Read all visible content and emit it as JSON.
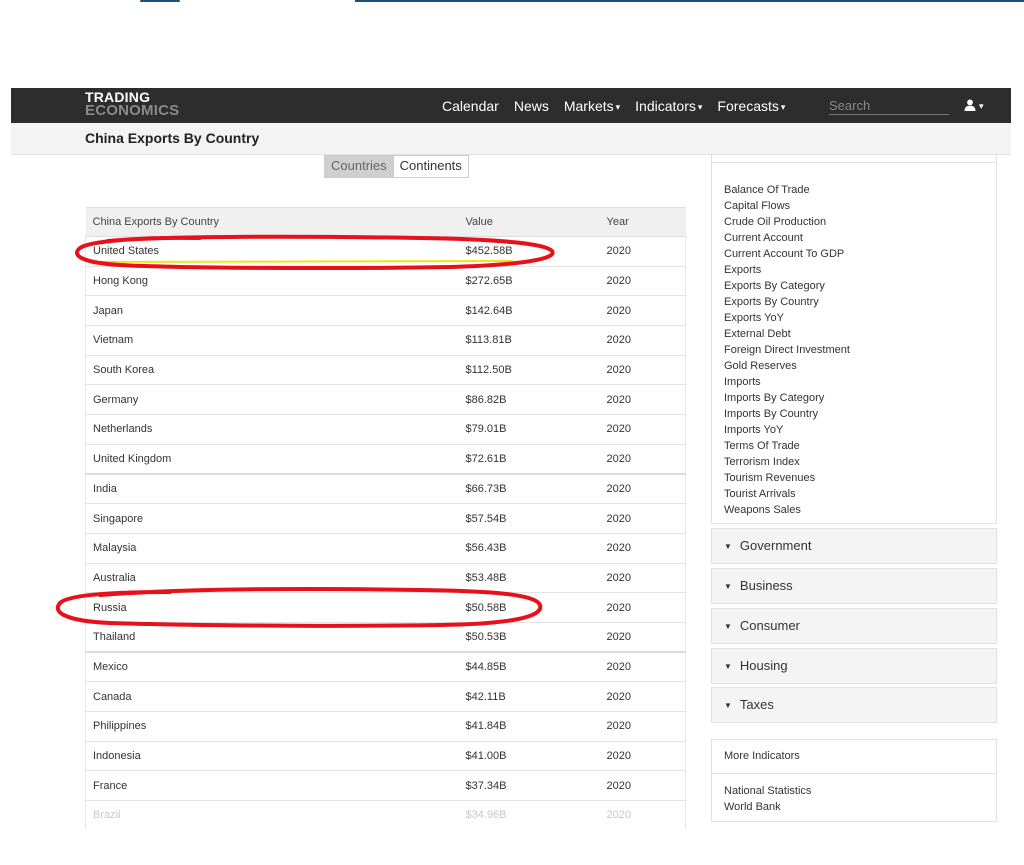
{
  "navbar": {
    "logo_line1": "TRADING",
    "logo_line2": "ECONOMICS",
    "menu": [
      {
        "label": "Calendar",
        "has_caret": false
      },
      {
        "label": "News",
        "has_caret": false
      },
      {
        "label": "Markets",
        "has_caret": true
      },
      {
        "label": "Indicators",
        "has_caret": true
      },
      {
        "label": "Forecasts",
        "has_caret": true
      }
    ],
    "search_placeholder": "Search",
    "user_icon": "user-icon"
  },
  "page": {
    "title": "China Exports By Country"
  },
  "toggle": {
    "options": [
      "Countries",
      "Continents"
    ],
    "active": "Countries"
  },
  "table": {
    "headers": [
      "China Exports By Country",
      "Value",
      "Year"
    ],
    "rows": [
      {
        "country": "United States",
        "value": "$452.58B",
        "year": "2020"
      },
      {
        "country": "Hong Kong",
        "value": "$272.65B",
        "year": "2020"
      },
      {
        "country": "Japan",
        "value": "$142.64B",
        "year": "2020"
      },
      {
        "country": "Vietnam",
        "value": "$113.81B",
        "year": "2020"
      },
      {
        "country": "South Korea",
        "value": "$112.50B",
        "year": "2020"
      },
      {
        "country": "Germany",
        "value": "$86.82B",
        "year": "2020"
      },
      {
        "country": "Netherlands",
        "value": "$79.01B",
        "year": "2020"
      },
      {
        "country": "United Kingdom",
        "value": "$72.61B",
        "year": "2020"
      },
      {
        "country": "India",
        "value": "$66.73B",
        "year": "2020"
      },
      {
        "country": "Singapore",
        "value": "$57.54B",
        "year": "2020"
      },
      {
        "country": "Malaysia",
        "value": "$56.43B",
        "year": "2020"
      },
      {
        "country": "Australia",
        "value": "$53.48B",
        "year": "2020"
      },
      {
        "country": "Russia",
        "value": "$50.58B",
        "year": "2020"
      },
      {
        "country": "Thailand",
        "value": "$50.53B",
        "year": "2020"
      },
      {
        "country": "Mexico",
        "value": "$44.85B",
        "year": "2020"
      },
      {
        "country": "Canada",
        "value": "$42.11B",
        "year": "2020"
      },
      {
        "country": "Philippines",
        "value": "$41.84B",
        "year": "2020"
      },
      {
        "country": "Indonesia",
        "value": "$41.00B",
        "year": "2020"
      },
      {
        "country": "France",
        "value": "$37.34B",
        "year": "2020"
      },
      {
        "country": "Brazil",
        "value": "$34.96B",
        "year": "2020"
      }
    ]
  },
  "annotations": {
    "circle_color": "#e8101a",
    "underline_color": "#f2e21a",
    "circled_rows": [
      "United States",
      "Russia"
    ]
  },
  "sidebar": {
    "trade_links": [
      "Balance Of Trade",
      "Capital Flows",
      "Crude Oil Production",
      "Current Account",
      "Current Account To GDP",
      "Exports",
      "Exports By Category",
      "Exports By Country",
      "Exports YoY",
      "External Debt",
      "Foreign Direct Investment",
      "Gold Reserves",
      "Imports",
      "Imports By Category",
      "Imports By Country",
      "Imports YoY",
      "Terms Of Trade",
      "Terrorism Index",
      "Tourism Revenues",
      "Tourist Arrivals",
      "Weapons Sales"
    ],
    "sections": [
      "Government",
      "Business",
      "Consumer",
      "Housing",
      "Taxes"
    ],
    "more_title": "More Indicators",
    "more_links": [
      "National Statistics",
      "World Bank"
    ]
  }
}
